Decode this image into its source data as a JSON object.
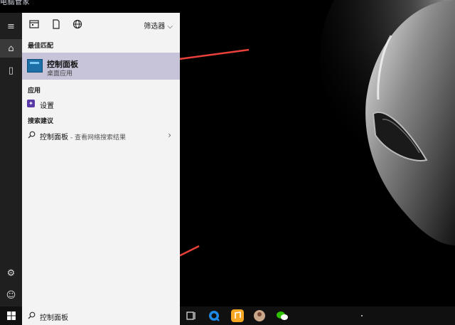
{
  "desktop": {
    "top_label": "电脑管家"
  },
  "panel": {
    "filter_label": "筛选器",
    "best_match_title": "最佳匹配",
    "best_match": {
      "name": "控制面板",
      "subtitle": "桌面应用"
    },
    "apps_title": "应用",
    "apps": [
      {
        "label": "设置"
      }
    ],
    "suggest_title": "搜索建议",
    "suggest": {
      "query": "控制面板",
      "hint": " - 查看网络搜索结果"
    }
  },
  "taskbar": {
    "search_text": "控制面板",
    "apps": [
      "task-view-icon",
      "browser-icon",
      "qq-music-icon",
      "avatar-app-icon",
      "wechat-icon"
    ]
  },
  "colors": {
    "accent_highlight": "#c7c4d9",
    "arrow": "#e8403a",
    "rail": "#1f1f1f",
    "panel": "#f3f3f3"
  }
}
